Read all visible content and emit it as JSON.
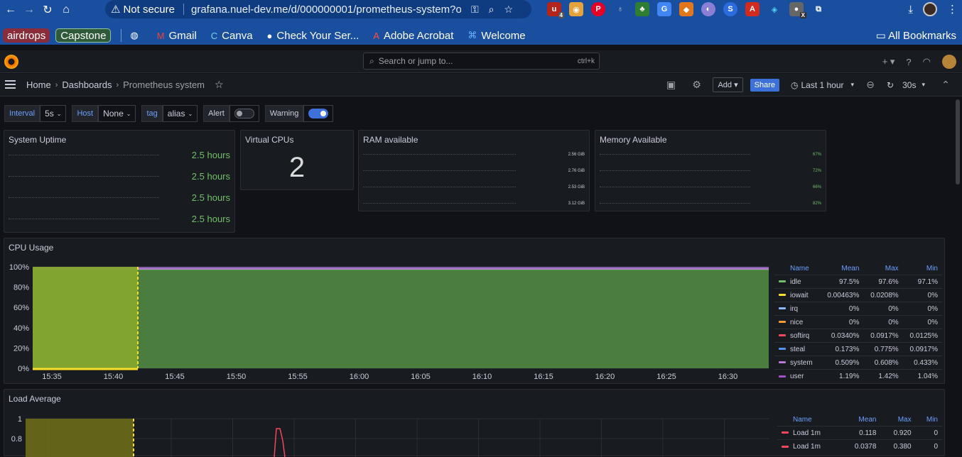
{
  "browser": {
    "security_label": "Not secure",
    "url": "grafana.nuel-dev.me/d/000000001/prometheus-system?o...",
    "extension_badges": [
      "4",
      "X"
    ],
    "bookmarks_chips": [
      "airdrops",
      "Capstone"
    ],
    "bookmarks": [
      "Gmail",
      "Canva",
      "Check Your Ser...",
      "Adobe Acrobat",
      "Welcome"
    ],
    "all_bookmarks": "All Bookmarks"
  },
  "grafana": {
    "search_placeholder": "Search or jump to...",
    "search_shortcut": "ctrl+k",
    "breadcrumb": [
      "Home",
      "Dashboards",
      "Prometheus system"
    ],
    "add_label": "Add",
    "share_label": "Share",
    "time_range": "Last 1 hour",
    "refresh": "30s"
  },
  "variables": {
    "interval_label": "Interval",
    "interval_value": "5s",
    "host_label": "Host",
    "host_value": "None",
    "tag_label": "tag",
    "tag_value": "alias",
    "alert_label": "Alert",
    "warning_label": "Warning"
  },
  "panels": {
    "uptime": {
      "title": "System Uptime",
      "values": [
        "2.5 hours",
        "2.5 hours",
        "2.5 hours",
        "2.5 hours"
      ]
    },
    "vcpus": {
      "title": "Virtual CPUs",
      "value": "2"
    },
    "ram": {
      "title": "RAM available",
      "values": [
        "2.56 GiB",
        "2.76 GiB",
        "2.53 GiB",
        "3.12 GiB"
      ]
    },
    "memory": {
      "title": "Memory Available",
      "values": [
        "67%",
        "72%",
        "66%",
        "82%"
      ]
    },
    "cpu": {
      "title": "CPU Usage"
    },
    "load": {
      "title": "Load Average"
    }
  },
  "chart_data": [
    {
      "type": "area",
      "title": "CPU Usage",
      "x": [
        "15:35",
        "15:40",
        "15:45",
        "15:50",
        "15:55",
        "16:00",
        "16:05",
        "16:10",
        "16:15",
        "16:20",
        "16:25",
        "16:30"
      ],
      "y_ticks": [
        "100%",
        "80%",
        "60%",
        "40%",
        "20%",
        "0%"
      ],
      "ylim": [
        0,
        100
      ],
      "legend_headers": [
        "Name",
        "Mean",
        "Max",
        "Min"
      ],
      "series": [
        {
          "name": "idle",
          "color": "#73bf69",
          "mean": "97.5%",
          "max": "97.6%",
          "min": "97.1%"
        },
        {
          "name": "iowait",
          "color": "#fade2a",
          "mean": "0.00463%",
          "max": "0.0208%",
          "min": "0%"
        },
        {
          "name": "irq",
          "color": "#8ab8ff",
          "mean": "0%",
          "max": "0%",
          "min": "0%"
        },
        {
          "name": "nice",
          "color": "#ff9830",
          "mean": "0%",
          "max": "0%",
          "min": "0%"
        },
        {
          "name": "softirq",
          "color": "#f2495c",
          "mean": "0.0340%",
          "max": "0.0917%",
          "min": "0.0125%"
        },
        {
          "name": "steal",
          "color": "#5794f2",
          "mean": "0.173%",
          "max": "0.775%",
          "min": "0.0917%"
        },
        {
          "name": "system",
          "color": "#b877d9",
          "mean": "0.509%",
          "max": "0.608%",
          "min": "0.433%"
        },
        {
          "name": "user",
          "color": "#a352cc",
          "mean": "1.19%",
          "max": "1.42%",
          "min": "1.04%"
        }
      ]
    },
    {
      "type": "line",
      "title": "Load Average",
      "y_ticks": [
        "1",
        "0.8"
      ],
      "legend_headers": [
        "Name",
        "Mean",
        "Max",
        "Min"
      ],
      "series": [
        {
          "name": "Load 1m",
          "color": "#f2495c",
          "mean": "0.118",
          "max": "0.920",
          "min": "0"
        },
        {
          "name": "Load 1m",
          "color": "#f2495c",
          "mean": "0.0378",
          "max": "0.380",
          "min": "0"
        }
      ]
    }
  ]
}
